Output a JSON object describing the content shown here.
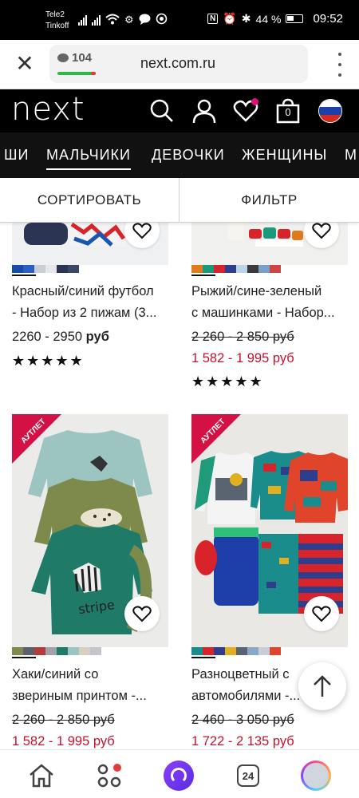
{
  "status_bar": {
    "carrier_1": "Tele2",
    "carrier_2": "Tinkoff",
    "battery": "44 %",
    "time": "09:52"
  },
  "browser": {
    "url": "next.com.ru",
    "comments_count": "104",
    "tabs_count": "24"
  },
  "header": {
    "logo": "next",
    "basket_count": "0"
  },
  "categories": [
    {
      "label": "ШИ"
    },
    {
      "label": "МАЛЬЧИКИ"
    },
    {
      "label": "ДЕВОЧКИ"
    },
    {
      "label": "ЖЕНЩИНЫ"
    },
    {
      "label": "М"
    }
  ],
  "toolbar": {
    "sort_label": "СОРТИРОВАТЬ",
    "filter_label": "ФИЛЬТР"
  },
  "products": [
    {
      "title_line1": "Красный/синий футбол",
      "title_line2": "- Набор из 2 пижам (3...",
      "price": "2260 - 2950",
      "currency": "руб",
      "rating": 5
    },
    {
      "title_line1": "Рыжий/сине-зеленый",
      "title_line2": "с машинками - Набор...",
      "old_price": "2 260 - 2 850 руб",
      "sale_price": "1 582 - 1 995 руб",
      "rating": 5
    },
    {
      "badge": "АУТЛЕТ",
      "title_line1": "Хаки/синий со",
      "title_line2": "звериным принтом -...",
      "old_price": "2 260 - 2 850 руб",
      "sale_price": "1 582 - 1 995 руб"
    },
    {
      "badge": "АУТЛЕТ",
      "title_line1": "Разноцветный с",
      "title_line2": "автомобилями -...",
      "old_price": "2 460 - 3 050 руб",
      "sale_price": "1 722 - 2 135 руб"
    }
  ],
  "colors": {
    "sale": "#c8102e",
    "badge": "#d31145",
    "header_bg": "#000000"
  }
}
